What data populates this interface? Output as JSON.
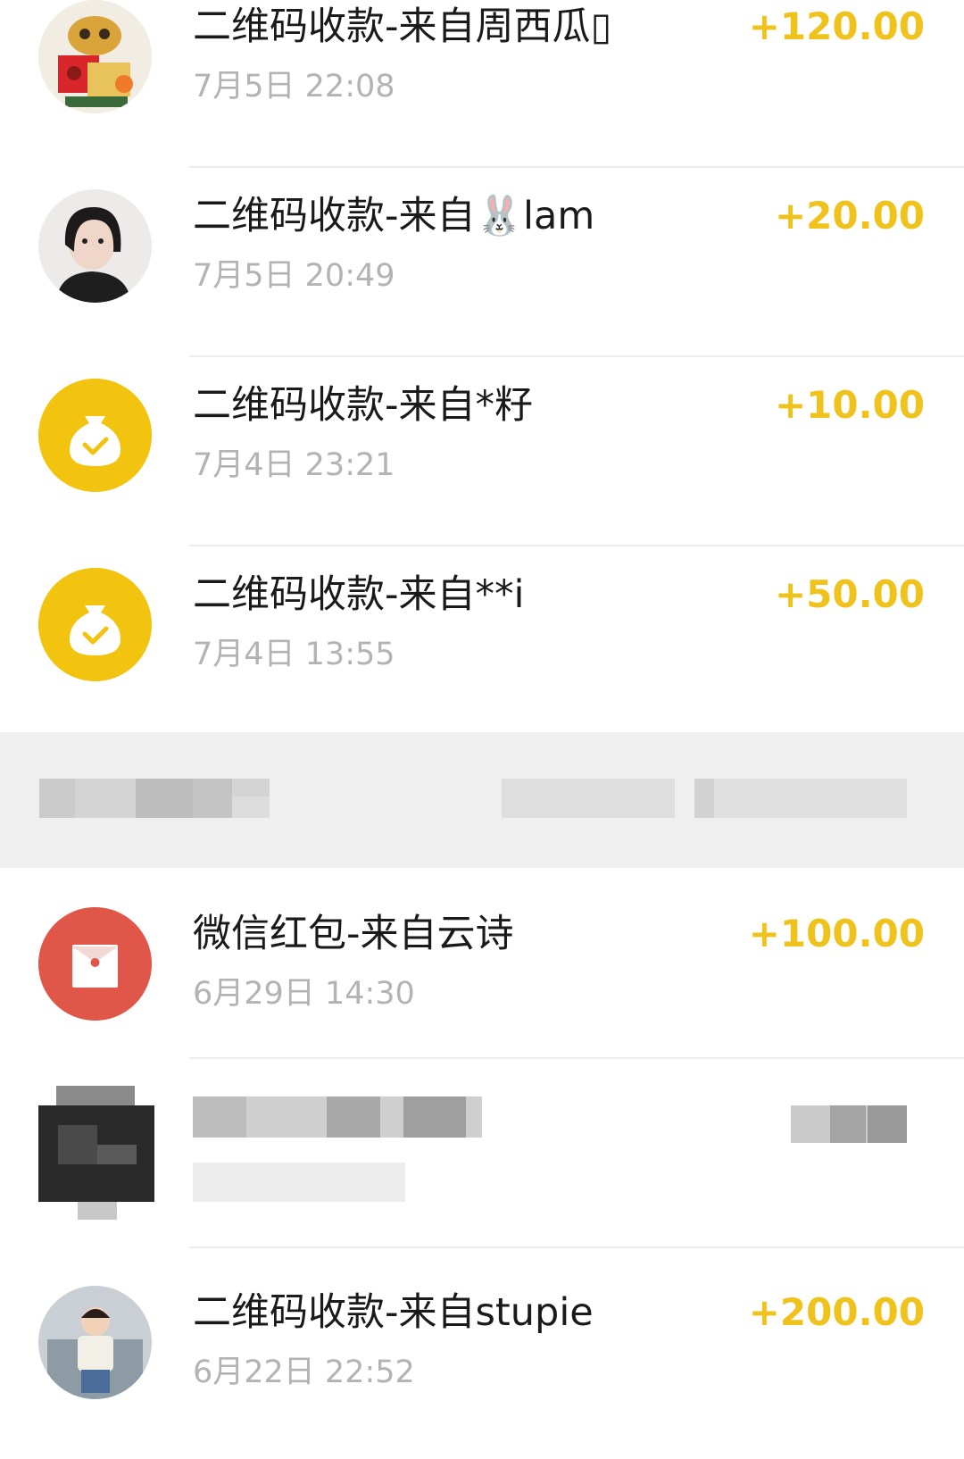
{
  "colors": {
    "amount": "#f0c21c",
    "money_bag_bg": "#f2c40f",
    "red_packet_bg": "#e0574a",
    "title_text": "#1a1a1a",
    "time_text": "#b3b3b3"
  },
  "transactions": [
    {
      "title": "二维码收款-来自周西瓜▯",
      "time": "7月5日 22:08",
      "amount": "+120.00",
      "icon": "user-avatar-figurine"
    },
    {
      "title": "二维码收款-来自🐰lam",
      "time": "7月5日 20:49",
      "amount": "+20.00",
      "icon": "user-avatar-woman"
    },
    {
      "title": "二维码收款-来自*籽",
      "time": "7月4日 23:21",
      "amount": "+10.00",
      "icon": "money-bag-icon"
    },
    {
      "title": "二维码收款-来自**i",
      "time": "7月4日 13:55",
      "amount": "+50.00",
      "icon": "money-bag-icon"
    },
    {
      "title": "微信红包-来自云诗",
      "time": "6月29日 14:30",
      "amount": "+100.00",
      "icon": "red-packet-icon"
    },
    {
      "title": "二维码收款-来自stupie",
      "time": "6月22日 22:52",
      "amount": "+200.00",
      "icon": "user-avatar-child"
    }
  ]
}
